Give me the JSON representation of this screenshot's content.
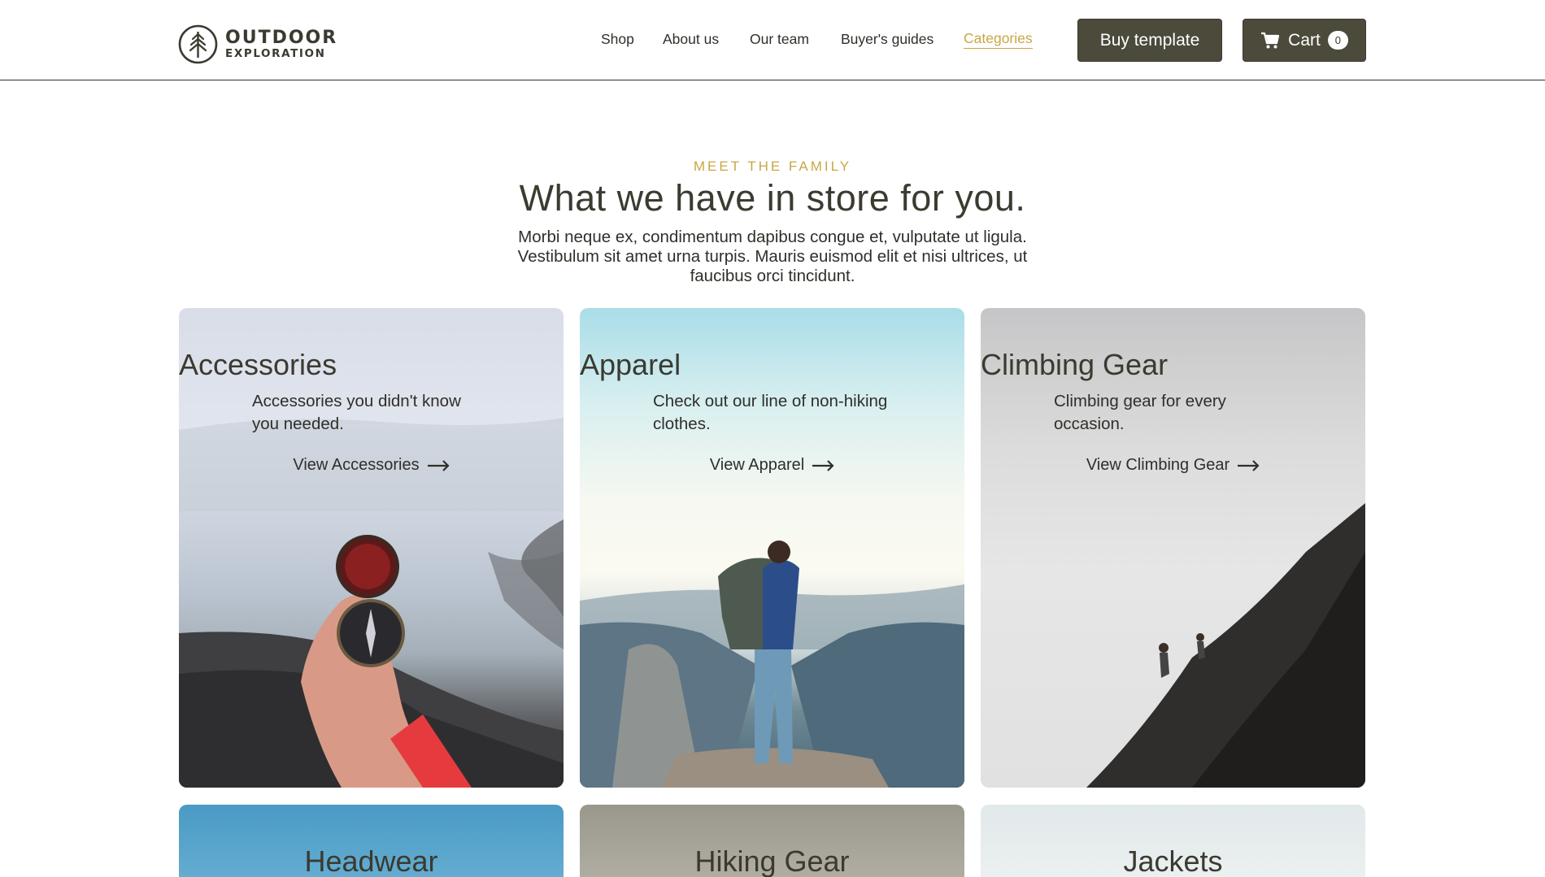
{
  "brand": {
    "line1": "OUTDOOR",
    "line2": "EXPLORATION",
    "icon": "tree-logo-icon"
  },
  "nav": {
    "items": [
      {
        "label": "Shop"
      },
      {
        "label": "About us"
      },
      {
        "label": "Our team"
      },
      {
        "label": "Buyer's guides"
      },
      {
        "label": "Categories"
      }
    ],
    "active": "Categories"
  },
  "buttons": {
    "buy_label": "Buy template",
    "cart_label": "Cart",
    "cart_count": "0"
  },
  "intro": {
    "eyebrow": "MEET THE FAMILY",
    "headline": "What we have in store for you.",
    "lede": "Morbi neque ex, condimentum dapibus congue et, vulputate ut ligula. Vestibulum sit amet urna turpis. Mauris euismod elit et nisi ultrices, ut faucibus orci tincidunt."
  },
  "categories": [
    {
      "title": "Accessories",
      "description": "Accessories you didn't know you needed.",
      "link": "View Accessories"
    },
    {
      "title": "Apparel",
      "description": "Check out our line of non-hiking clothes.",
      "link": "View Apparel"
    },
    {
      "title": "Climbing Gear",
      "description": "Climbing gear for every occasion.",
      "link": "View Climbing Gear"
    },
    {
      "title": "Headwear"
    },
    {
      "title": "Hiking Gear"
    },
    {
      "title": "Jackets"
    }
  ],
  "colors": {
    "accent": "#c9a646",
    "dark": "#4b4a3b",
    "text": "#3c3b30"
  }
}
